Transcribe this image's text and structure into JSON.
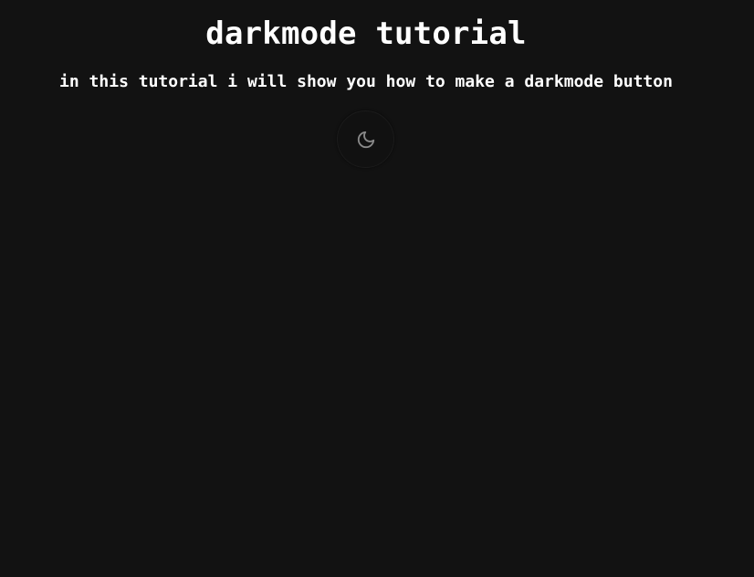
{
  "header": {
    "title": "darkmode tutorial",
    "subtitle": "in this tutorial i will show you how to make a darkmode button"
  },
  "toggle": {
    "icon": "moon-icon",
    "icon_color": "#8a8a8a"
  },
  "colors": {
    "background": "#121212",
    "text": "#ffffff"
  }
}
